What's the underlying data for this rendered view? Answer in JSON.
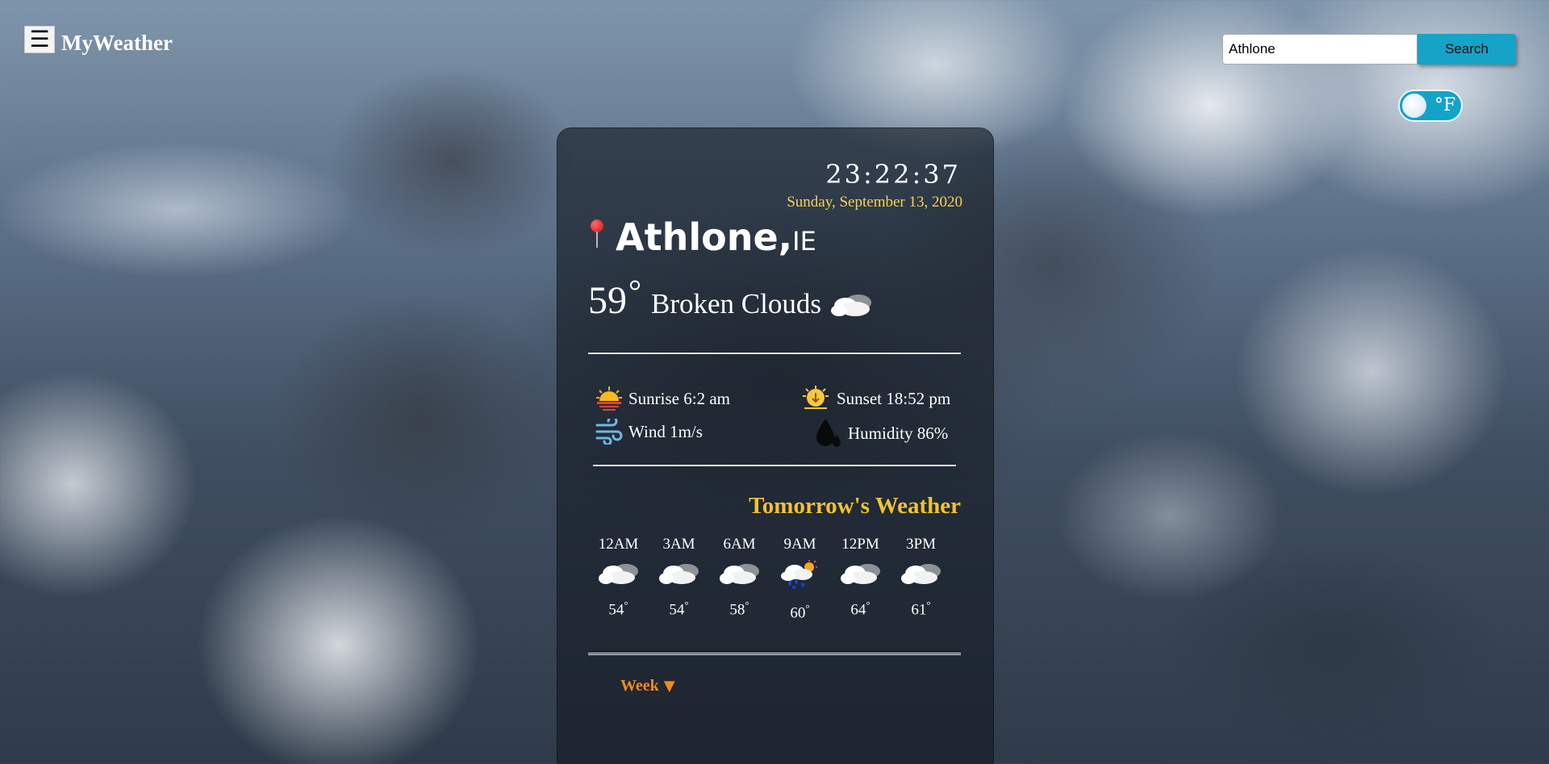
{
  "app": {
    "title": "MyWeather",
    "menu_icon": "hamburger-menu-icon"
  },
  "search": {
    "value": "Athlone",
    "button_label": "Search"
  },
  "unit_toggle": {
    "label": "°F"
  },
  "current": {
    "time": "23:22:37",
    "date": "Sunday, September 13, 2020",
    "city": "Athlone,",
    "country": "IE",
    "temperature": "59",
    "degree_symbol": "°",
    "description": "Broken Clouds",
    "condition_icon": "cloud-icon"
  },
  "stats": {
    "sunrise": "Sunrise 6:2 am",
    "sunset": "Sunset 18:52 pm",
    "wind": "Wind 1m/s",
    "humidity": "Humidity 86%"
  },
  "tomorrow": {
    "title": "Tomorrow's Weather",
    "hours": [
      {
        "time": "12AM",
        "temp": "54",
        "icon": "cloudy-icon"
      },
      {
        "time": "3AM",
        "temp": "54",
        "icon": "cloudy-icon"
      },
      {
        "time": "6AM",
        "temp": "58",
        "icon": "cloudy-icon"
      },
      {
        "time": "9AM",
        "temp": "60",
        "icon": "rain-sun-icon"
      },
      {
        "time": "12PM",
        "temp": "64",
        "icon": "cloudy-icon"
      },
      {
        "time": "3PM",
        "temp": "61",
        "icon": "cloudy-icon"
      }
    ],
    "degree_symbol": "°"
  },
  "week_toggle": {
    "label": "Week",
    "arrow": "▼"
  },
  "colors": {
    "accent_blue": "#17a2c7",
    "date_yellow": "#f7d34a",
    "tomorrow_yellow": "#f2c230",
    "week_orange": "#f58a1f"
  }
}
